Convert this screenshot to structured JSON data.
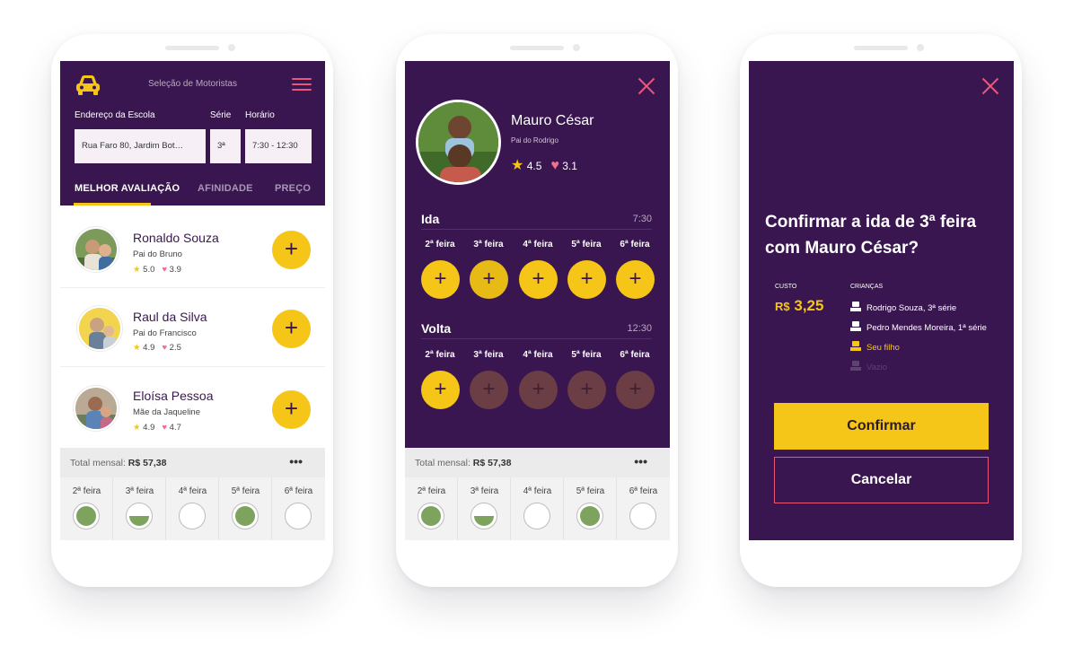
{
  "colors": {
    "purple": "#3a1650",
    "yellow": "#f5c518",
    "pink": "#e8587a",
    "green": "#7ea35f"
  },
  "screen1": {
    "header_title": "Seleção de Motoristas",
    "labels": {
      "address": "Endereço da Escola",
      "grade": "Série",
      "time": "Horário"
    },
    "values": {
      "address": "Rua Faro 80, Jardim Bot…",
      "grade": "3ª",
      "time": "7:30 - 12:30"
    },
    "tabs": [
      "MELHOR AVALIAÇÃO",
      "AFINIDADE",
      "PREÇO"
    ],
    "drivers": [
      {
        "name": "Ronaldo Souza",
        "sub": "Pai do Bruno",
        "stars": "5.0",
        "hearts": "3.9"
      },
      {
        "name": "Raul da Silva",
        "sub": "Pai do Francisco",
        "stars": "4.9",
        "hearts": "2.5"
      },
      {
        "name": "Eloísa Pessoa",
        "sub": "Mãe da Jaqueline",
        "stars": "4.9",
        "hearts": "4.7"
      }
    ],
    "add_symbol": "+"
  },
  "summary": {
    "total_label": "Total mensal:",
    "total_value": "R$ 57,38",
    "more": "•••",
    "days": [
      "2ª feira",
      "3ª feira",
      "4ª feira",
      "5ª feira",
      "6ª  feira"
    ],
    "day_fill": [
      "full",
      "half",
      "empty",
      "full",
      "empty"
    ]
  },
  "screen2": {
    "name": "Mauro César",
    "sub": "Pai do Rodrigo",
    "stars": "4.5",
    "hearts": "3.1",
    "ida": {
      "title": "Ida",
      "time": "7:30"
    },
    "volta": {
      "title": "Volta",
      "time": "12:30"
    },
    "weekdays": [
      "2ª feira",
      "3ª feira",
      "4ª feira",
      "5ª feira",
      "6ª  feira"
    ],
    "ida_state": [
      "on",
      "selected",
      "on",
      "on",
      "on"
    ],
    "volta_state": [
      "on",
      "off",
      "off",
      "off",
      "off"
    ],
    "add_symbol": "+"
  },
  "screen3": {
    "title": "Confirmar a ida de 3ª feira com Mauro César?",
    "cost_label": "CUSTO",
    "cost_currency": "R$",
    "cost_value": "3,25",
    "kids_label": "CRIANÇAS",
    "kids": [
      {
        "name": "Rodrigo Souza, 3ª série",
        "state": "taken"
      },
      {
        "name": "Pedro Mendes Moreira, 1ª série",
        "state": "taken"
      },
      {
        "name": "Seu filho",
        "state": "you"
      },
      {
        "name": "Vazio",
        "state": "empty"
      }
    ],
    "confirm": "Confirmar",
    "cancel": "Cancelar"
  }
}
